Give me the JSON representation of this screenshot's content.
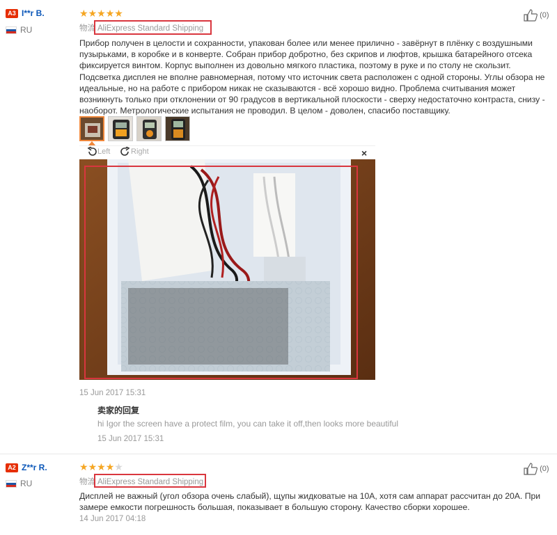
{
  "reviews": [
    {
      "level": "A3",
      "username": "I**r B.",
      "country": "RU",
      "stars": 5,
      "likes": "(0)",
      "shipping_label": "物流",
      "shipping_method": "AliExpress Standard Shipping",
      "text": "Прибор получен в целости и сохранности, упакован более или менее прилично - завёрнут в плёнку с воздушными пузырьками, в коробке и в конверте. Собран прибор добротно, без скрипов и люфтов, крышка батарейного отсека фиксируется винтом. Корпус выполнен из довольно мягкого пластика, поэтому в руке и по столу не скользит. Подсветка дисплея не вполне равномерная, потому что источник света расположен с одной стороны. Углы обзора не идеальные, но на работе с прибором никак не сказываются - всё хорошо видно. Проблема считывания может возникнуть только при отклонении от 90 градусов в вертикальной плоскости - сверху недостаточно контраста, снизу - наоборот. Метрологические испытания не проводил. В целом - доволен, спасибо поставщику.",
      "date": "15 Jun 2017 15:31",
      "viewer": {
        "left": "Left",
        "right": "Right",
        "close": "×"
      },
      "seller_reply": {
        "title": "卖家的回复",
        "text": "hi Igor the screen have a protect film, you can take it off,then looks more beautiful",
        "date": "15 Jun 2017 15:31"
      }
    },
    {
      "level": "A2",
      "username": "Z**r R.",
      "country": "RU",
      "stars": 4,
      "likes": "(0)",
      "shipping_label": "物流",
      "shipping_method": "AliExpress Standard Shipping",
      "text": "Дисплей не важный (угол обзора очень слабый), щупы жидковатые на 10А, хотя сам аппарат рассчитан до 20А. При замере емкости погрешность большая, показывает в большую сторону. Качество сборки хорошее.",
      "date": "14 Jun 2017 04:18"
    }
  ],
  "colors": {
    "accent": "#e62e04",
    "link": "#0a56b8",
    "star": "#f5a623",
    "highlight": "#d9363e"
  }
}
